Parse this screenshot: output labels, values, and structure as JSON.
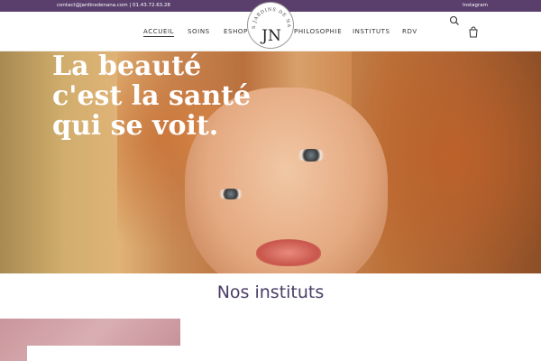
{
  "topbar": {
    "contact": "contact@jardinsdenana.com | 01.43.72.63.28",
    "social": "Instagram",
    "bg_color": "#5a3f6d"
  },
  "nav": {
    "items": [
      {
        "label": "Accueil",
        "active": true
      },
      {
        "label": "Soins",
        "active": false
      },
      {
        "label": "Eshop",
        "active": false
      },
      {
        "label": "Philosophie",
        "active": false
      },
      {
        "label": "Instituts",
        "active": false
      },
      {
        "label": "RDV",
        "active": false
      }
    ],
    "icons": {
      "search": "search-icon",
      "cart": "cart-icon"
    }
  },
  "logo": {
    "monogram": "JN",
    "text": "LES JARDINS DE NANA"
  },
  "hero": {
    "title_lines": [
      "La beauté",
      "c'est la santé",
      "qui se voit."
    ]
  },
  "section": {
    "title": "Nos instituts",
    "accent_color": "#4a3d66"
  }
}
